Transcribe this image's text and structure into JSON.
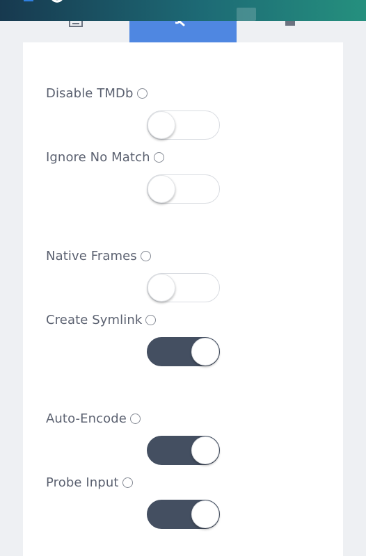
{
  "header": {
    "tabs": [
      {
        "icon": "image-icon"
      },
      {
        "icon": "search-icon",
        "active": true
      },
      {
        "icon": "square-icon"
      }
    ]
  },
  "colors": {
    "accent": "#4f87e1",
    "toggle_on": "#444f61",
    "text": "#5b6170"
  },
  "settings": [
    {
      "label": "Disable TMDb",
      "state": "off"
    },
    {
      "label": "Ignore No Match",
      "state": "off"
    },
    {
      "label": "Native Frames",
      "state": "off"
    },
    {
      "label": "Create Symlink",
      "state": "on"
    },
    {
      "label": "Auto-Encode",
      "state": "on"
    },
    {
      "label": "Probe Input",
      "state": "on"
    }
  ]
}
